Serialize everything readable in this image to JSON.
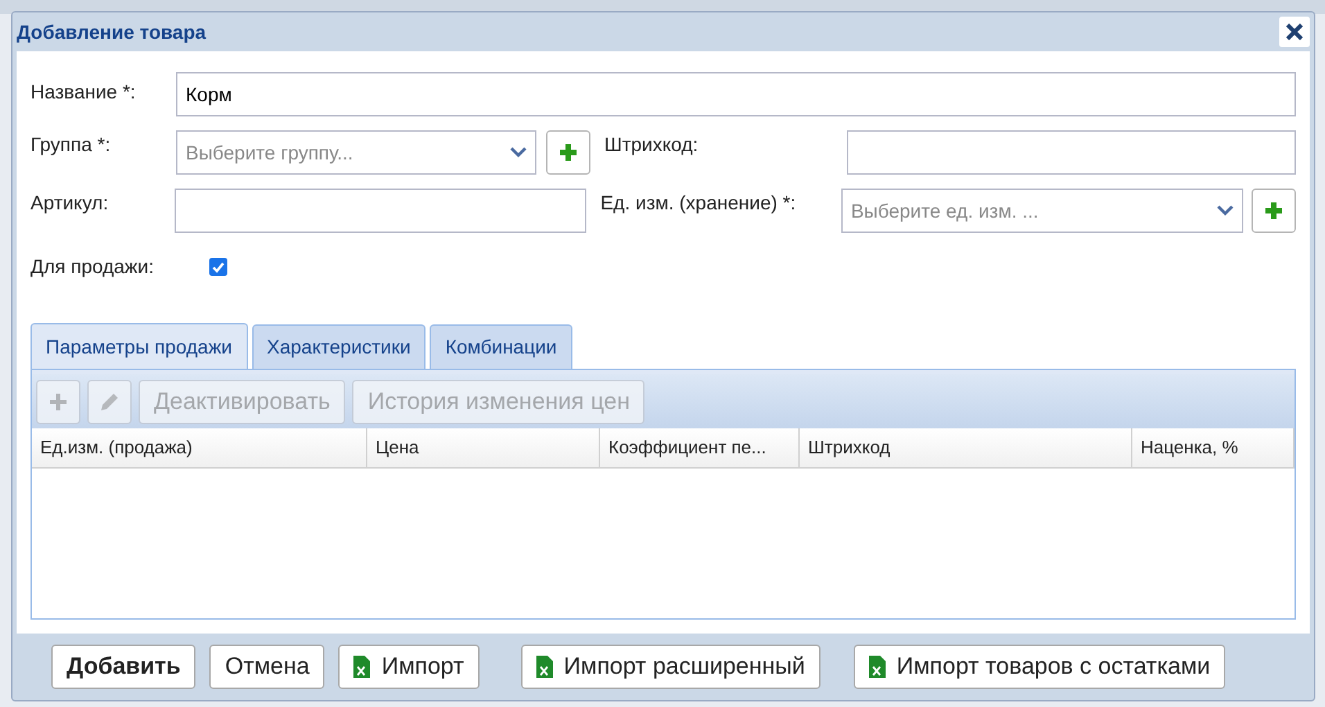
{
  "window": {
    "title": "Добавление товара"
  },
  "form": {
    "name": {
      "label": "Название *:",
      "value": "Корм"
    },
    "group": {
      "label": "Группа *:",
      "placeholder": "Выберите группу..."
    },
    "barcode": {
      "label": "Штрихкод:"
    },
    "article": {
      "label": "Артикул:"
    },
    "unit": {
      "label": "Ед. изм. (хранение) *:",
      "placeholder": "Выберите ед. изм. ..."
    },
    "for_sale": {
      "label": "Для продажи:",
      "checked": true
    }
  },
  "tabs": [
    {
      "label": "Параметры продажи",
      "selected": true
    },
    {
      "label": "Характеристики",
      "selected": false
    },
    {
      "label": "Комбинации",
      "selected": false
    }
  ],
  "toolbar": [
    {
      "kind": "add",
      "disabled": true
    },
    {
      "kind": "edit",
      "disabled": true
    },
    {
      "kind": "text",
      "label": "Деактивировать",
      "disabled": true
    },
    {
      "kind": "text",
      "label": "История изменения цен",
      "disabled": true
    }
  ],
  "table": {
    "columns": [
      "Ед.изм. (продажа)",
      "Цена",
      "Коэффициент пе...",
      "Штрихкод",
      "Наценка, %"
    ]
  },
  "buttons": [
    {
      "label": "Добавить",
      "kind": "primary"
    },
    {
      "label": "Отмена",
      "kind": "plain"
    },
    {
      "label": "Импорт",
      "kind": "excel"
    },
    {
      "label": "Импорт расширенный",
      "kind": "excel"
    },
    {
      "label": "Импорт товаров с остатками",
      "kind": "excel"
    }
  ]
}
